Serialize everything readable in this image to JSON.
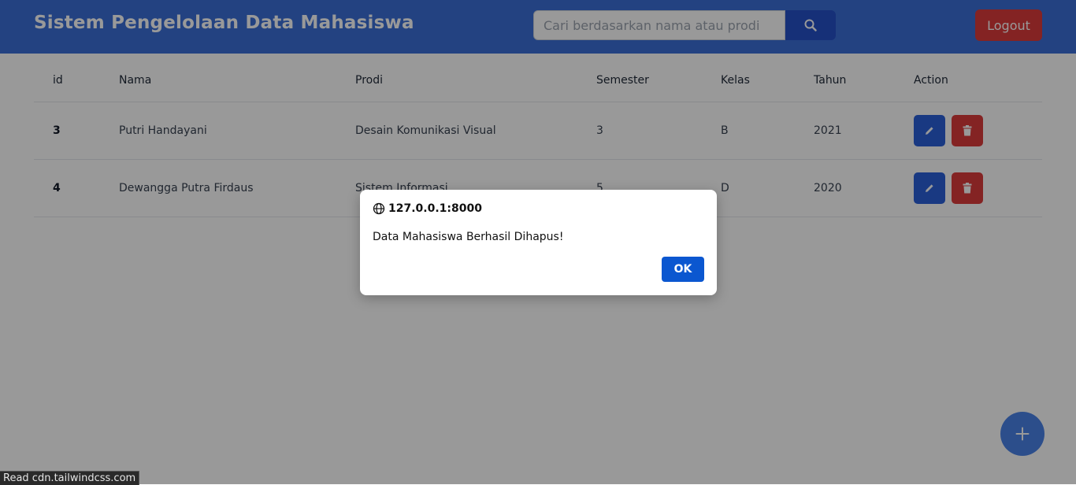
{
  "header": {
    "title": "Sistem Pengelolaan Data Mahasiswa",
    "search_placeholder": "Cari berdasarkan nama atau prodi",
    "search_icon": "search-icon",
    "logout_label": "Logout"
  },
  "table": {
    "columns": [
      "id",
      "Nama",
      "Prodi",
      "Semester",
      "Kelas",
      "Tahun",
      "Action"
    ],
    "rows": [
      {
        "id": "3",
        "nama": "Putri Handayani",
        "prodi": "Desain Komunikasi Visual",
        "semester": "3",
        "kelas": "B",
        "tahun": "2021"
      },
      {
        "id": "4",
        "nama": "Dewangga Putra Firdaus",
        "prodi": "Sistem Informasi",
        "semester": "5",
        "kelas": "D",
        "tahun": "2020"
      }
    ],
    "action_icons": [
      "pencil-icon",
      "trash-icon"
    ]
  },
  "dialog": {
    "origin": "127.0.0.1:8000",
    "message": "Data Mahasiswa Berhasil Dihapus!",
    "ok_label": "OK"
  },
  "fab_icon": "plus-icon",
  "status_bar": "Read cdn.tailwindcss.com",
  "colors": {
    "header_bg": "#3b6fd8",
    "primary": "#2b5fd9",
    "danger": "#dc3b3b",
    "dialog_button": "#0b57d0"
  }
}
